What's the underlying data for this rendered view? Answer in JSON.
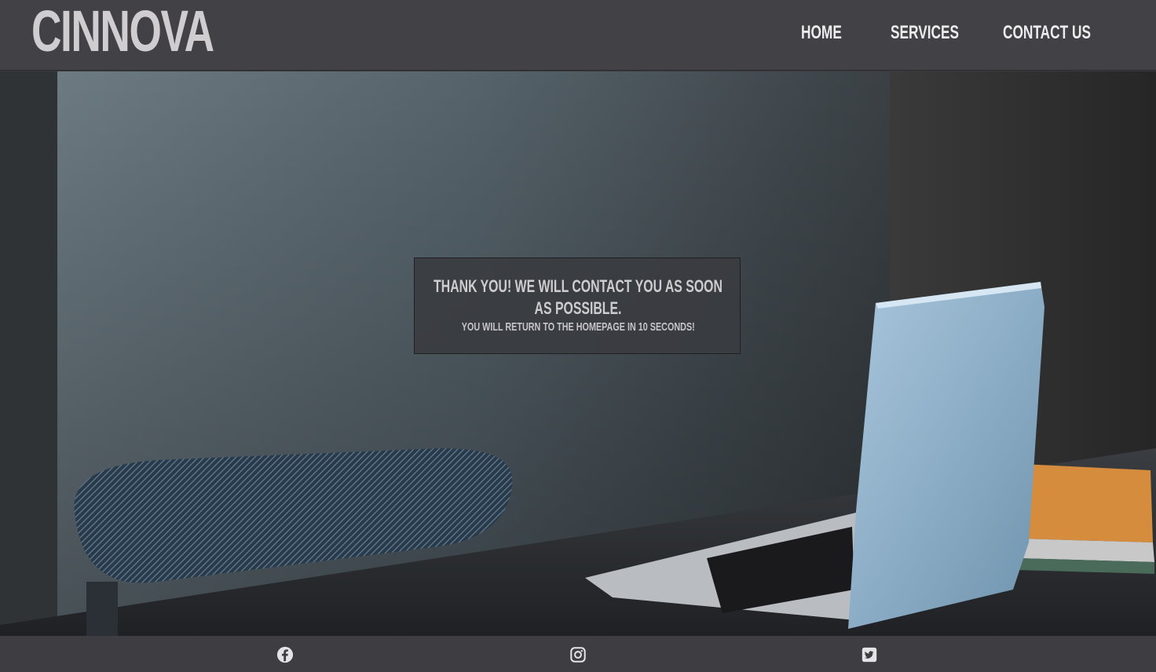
{
  "header": {
    "logo": "CINNOVA",
    "nav": [
      {
        "label": "HOME"
      },
      {
        "label": "SERVICES"
      },
      {
        "label": "CONTACT US"
      }
    ]
  },
  "message": {
    "title": "THANK YOU! WE WILL CONTACT YOU AS SOON AS POSSIBLE.",
    "subtitle": "YOU WILL RETURN TO THE HOMEPAGE IN 10 SECONDS!"
  },
  "footer": {
    "social": [
      {
        "icon": "facebook-icon"
      },
      {
        "icon": "instagram-icon"
      },
      {
        "icon": "twitter-icon"
      }
    ]
  },
  "colors": {
    "header_bg": "#414146",
    "footer_bg": "#3e3e42",
    "logo": "#cfcdd0",
    "nav_text": "#ececec"
  }
}
